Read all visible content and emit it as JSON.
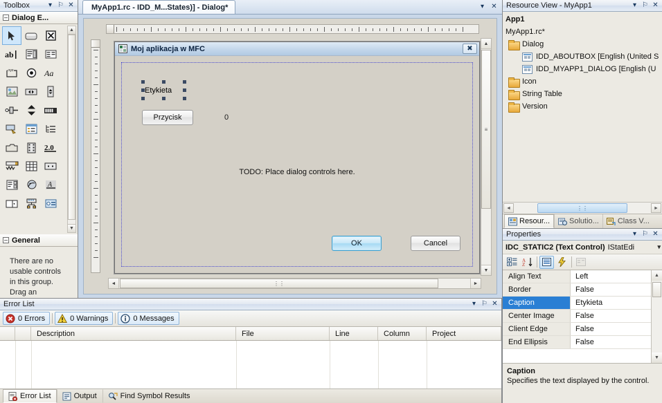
{
  "toolbox": {
    "title": "Toolbox",
    "group_dialog": "Dialog E...",
    "group_general": "General",
    "empty_text": "There are no usable controls in this group. Drag an",
    "items": [
      {
        "name": "pointer",
        "selected": true
      },
      {
        "name": "button"
      },
      {
        "name": "check-box"
      },
      {
        "name": "edit-control"
      },
      {
        "name": "combo-box"
      },
      {
        "name": "list-box"
      },
      {
        "name": "group-box"
      },
      {
        "name": "radio-button"
      },
      {
        "name": "static-text"
      },
      {
        "name": "picture-control"
      },
      {
        "name": "horizontal-scroll-bar"
      },
      {
        "name": "vertical-scroll-bar"
      },
      {
        "name": "slider-control"
      },
      {
        "name": "spin-control"
      },
      {
        "name": "progress-control"
      },
      {
        "name": "hot-key"
      },
      {
        "name": "list-control"
      },
      {
        "name": "tree-control"
      },
      {
        "name": "tab-control"
      },
      {
        "name": "animation-control"
      },
      {
        "name": "rich-edit-2-0-control"
      },
      {
        "name": "date-time-picker"
      },
      {
        "name": "month-calendar-control"
      },
      {
        "name": "ip-address-control"
      },
      {
        "name": "extended-combo-box"
      },
      {
        "name": "custom-control"
      },
      {
        "name": "syslink-control"
      },
      {
        "name": "split-button-control"
      },
      {
        "name": "network-address-control"
      },
      {
        "name": "command-link-control"
      }
    ]
  },
  "editor": {
    "tab_title": "MyApp1.rc - IDD_M...States)] - Dialog*",
    "dialog": {
      "caption": "Moj aplikacja w MFC",
      "close_glyph": "✖",
      "label": "Etykieta",
      "button": "Przycisk",
      "counter": "0",
      "todo": "TODO: Place dialog controls here.",
      "ok": "OK",
      "cancel": "Cancel"
    }
  },
  "error_list": {
    "title": "Error List",
    "errors": "0 Errors",
    "warnings": "0 Warnings",
    "messages": "0 Messages",
    "columns": [
      "Description",
      "File",
      "Line",
      "Column",
      "Project"
    ],
    "rows": [],
    "tabs": [
      {
        "label": "Error List",
        "active": true,
        "icon": "error-list-icon"
      },
      {
        "label": "Output",
        "active": false,
        "icon": "output-icon"
      },
      {
        "label": "Find Symbol Results",
        "active": false,
        "icon": "find-symbol-icon"
      }
    ]
  },
  "resource_view": {
    "title": "Resource View - MyApp1",
    "tree": [
      {
        "label": "App1",
        "type": "root",
        "indent": 0
      },
      {
        "label": "MyApp1.rc*",
        "type": "file",
        "indent": 0
      },
      {
        "label": "Dialog",
        "type": "folder",
        "indent": 1
      },
      {
        "label": "IDD_ABOUTBOX [English (United S",
        "type": "dialog",
        "indent": 2
      },
      {
        "label": "IDD_MYAPP1_DIALOG [English (U",
        "type": "dialog",
        "indent": 2
      },
      {
        "label": "Icon",
        "type": "folder",
        "indent": 1
      },
      {
        "label": "String Table",
        "type": "folder",
        "indent": 1
      },
      {
        "label": "Version",
        "type": "folder",
        "indent": 1
      }
    ],
    "tabs": [
      {
        "label": "Resour...",
        "active": true
      },
      {
        "label": "Solutio...",
        "active": false
      },
      {
        "label": "Class V...",
        "active": false
      }
    ]
  },
  "properties": {
    "title": "Properties",
    "object_name": "IDC_STATIC2 (Text Control)",
    "object_class": "IStatEdi",
    "toolbar": [
      {
        "name": "categorized-button",
        "active": false
      },
      {
        "name": "alphabetical-sort-button",
        "active": false
      },
      {
        "name": "properties-button",
        "active": true
      },
      {
        "name": "events-button",
        "active": false
      },
      {
        "name": "property-pages-button",
        "active": false,
        "disabled": true
      }
    ],
    "rows": [
      {
        "key": "Align Text",
        "value": "Left",
        "selected": false
      },
      {
        "key": "Border",
        "value": "False",
        "selected": false
      },
      {
        "key": "Caption",
        "value": "Etykieta",
        "selected": true
      },
      {
        "key": "Center Image",
        "value": "False",
        "selected": false
      },
      {
        "key": "Client Edge",
        "value": "False",
        "selected": false
      },
      {
        "key": "End Ellipsis",
        "value": "False",
        "selected": false
      }
    ],
    "description_title": "Caption",
    "description_text": "Specifies the text displayed by the control."
  },
  "window_buttons": {
    "dropdown": "▾",
    "pin": "⚐",
    "close": "✕",
    "left_arrow": "◄",
    "right_arrow": "►",
    "up_arrow": "▲",
    "down_arrow": "▼",
    "grip": "⦀"
  }
}
